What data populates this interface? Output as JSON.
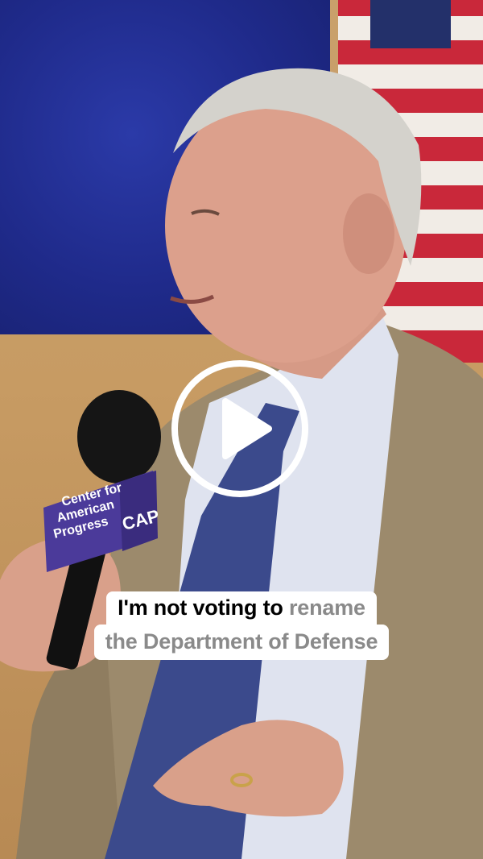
{
  "video": {
    "mic_label": {
      "line1": "Center for",
      "line2": "American",
      "line3": "Progress",
      "logo": "CAP"
    },
    "caption": {
      "line1_pre": "I'm not voting to",
      "line1_highlight": "rename",
      "line2": "the Department of Defense"
    },
    "play_icon": "play-icon"
  },
  "colors": {
    "caption_bg": "#ffffff",
    "caption_text": "#000000",
    "caption_highlight": "#8a8a8a",
    "backdrop_blue": "#1f2a8a",
    "wall": "#c79b63"
  }
}
